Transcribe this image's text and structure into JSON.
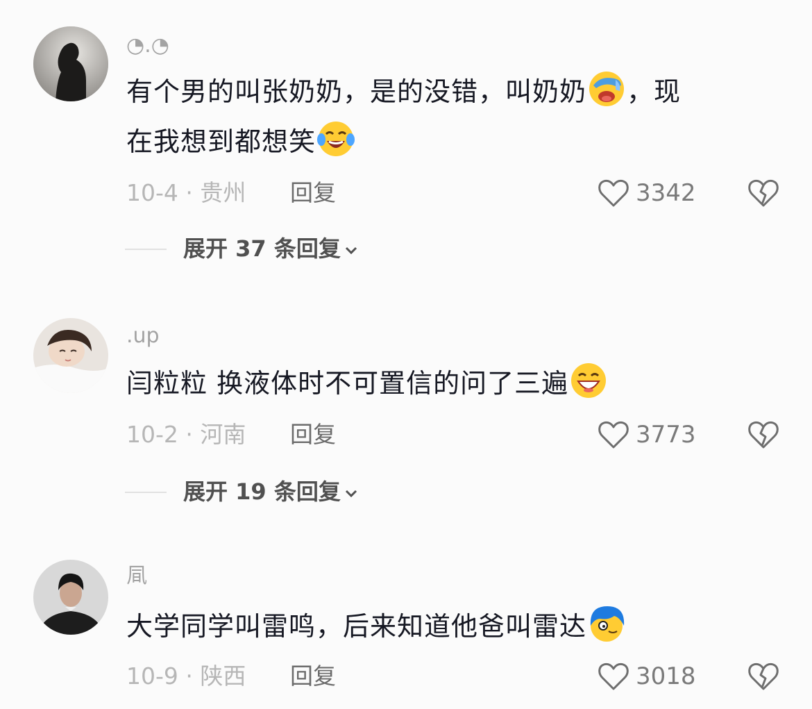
{
  "comments": [
    {
      "username": "◔.◔",
      "text_a": "有个男的叫张奶奶，是的没错，叫奶奶",
      "text_b": "，现",
      "text_c": "在我想到都想笑",
      "date_loc": "10-4 · 贵州",
      "reply_label": "回复",
      "likes": "3342",
      "expand_label": "展开 37 条回复",
      "emojis": [
        "facepalm-laugh-emoji",
        "tears-of-joy-emoji"
      ]
    },
    {
      "username": ".up",
      "text_a": "闫粒粒 换液体时不可置信的问了三遍",
      "date_loc": "10-2 · 河南",
      "reply_label": "回复",
      "likes": "3773",
      "expand_label": "展开 19 条回复",
      "emojis": [
        "grinning-emoji"
      ]
    },
    {
      "username": "凬",
      "text_a": "大学同学叫雷鸣，后来知道他爸叫雷达",
      "date_loc": "10-9 · 陕西",
      "reply_label": "回复",
      "likes": "3018",
      "emojis": [
        "blue-hair-emoji"
      ]
    }
  ],
  "icons": {
    "like": "heart-outline-icon",
    "dislike": "broken-heart-icon",
    "expand": "chevron-down-icon"
  },
  "colors": {
    "background": "#fbfbfb",
    "text": "#161823",
    "muted": "#b6b6b6",
    "username": "#a3a3a3"
  }
}
